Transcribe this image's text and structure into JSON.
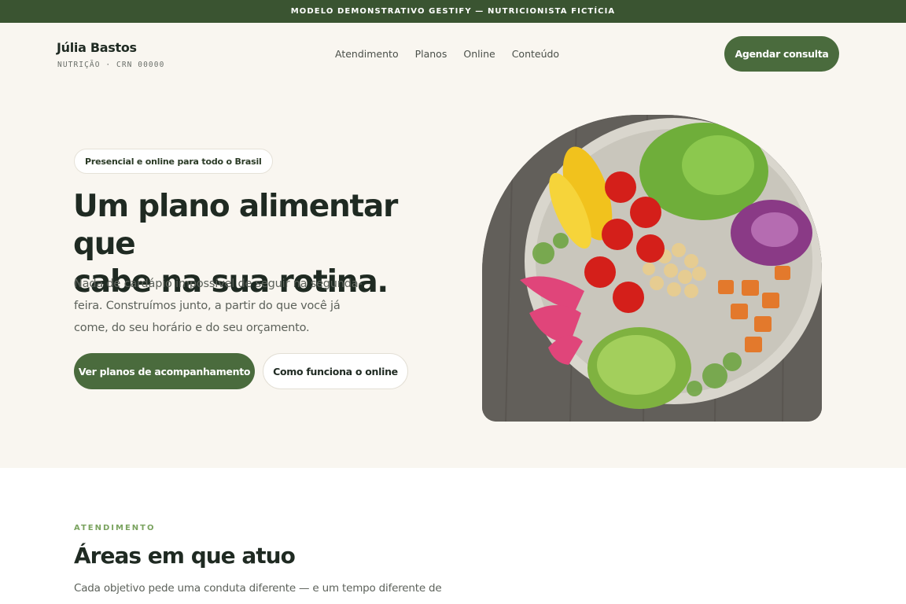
{
  "topbar": {
    "text": "MODELO DEMONSTRATIVO GESTIFY — NUTRICIONISTA FICTÍCIA"
  },
  "header": {
    "brand_name": "Júlia Bastos",
    "brand_sub": "NUTRIÇÃO · CRN 00000",
    "nav": [
      "Atendimento",
      "Planos",
      "Online",
      "Conteúdo"
    ],
    "cta_label": "Agendar consulta"
  },
  "hero": {
    "pill": "Presencial e online para todo o Brasil",
    "title_line1": "Um plano alimentar que",
    "title_line2": "cabe na sua rotina.",
    "desc": "Nada de cardápio impossível de seguir na segunda-feira. Construímos junto, a partir do que você já come, do seu horário e do seu orçamento.",
    "btn_primary": "Ver planos de acompanhamento",
    "btn_secondary": "Como funciona o online",
    "image": "salad-bowl-photo"
  },
  "section": {
    "eyebrow": "ATENDIMENTO",
    "title": "Áreas em que atuo",
    "desc": "Cada objetivo pede uma conduta diferente — e um tempo diferente de"
  },
  "colors": {
    "accent": "#4a6b3d",
    "topbar": "#3a5431",
    "hero_bg": "#f9f6f0",
    "eyebrow": "#7aa35f"
  }
}
